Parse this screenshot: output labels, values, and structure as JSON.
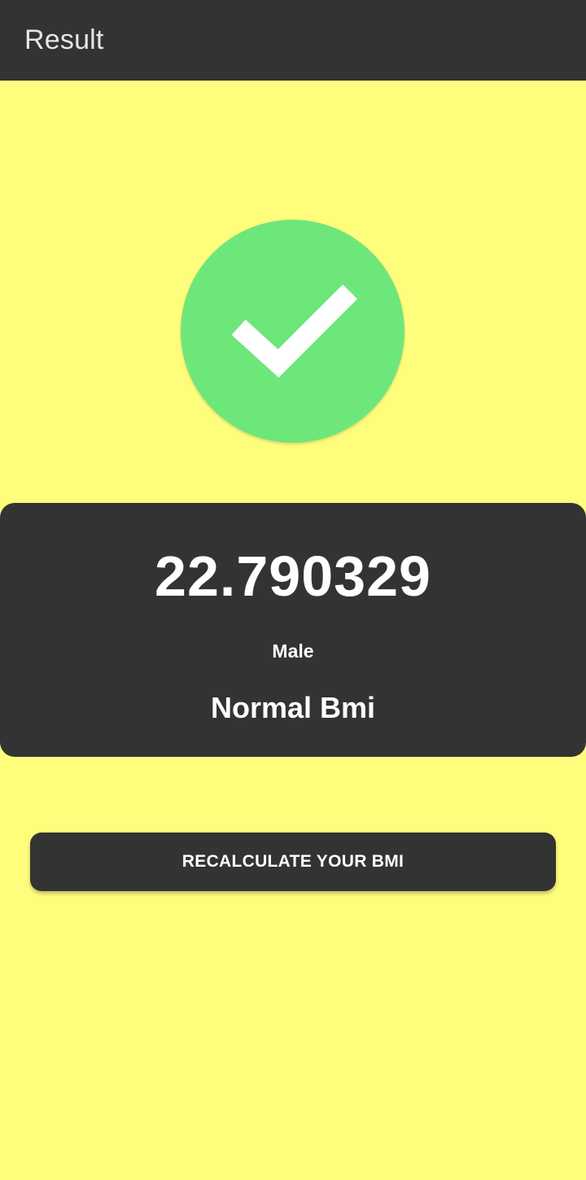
{
  "colors": {
    "app_bar_bg": "#333333",
    "app_bar_text": "#e6e6e6",
    "page_bg": "#fffd7c",
    "card_bg": "#333333",
    "card_text": "#ffffff",
    "button_bg": "#333333",
    "button_text": "#ffffff",
    "check_circle": "#6ee77a",
    "check_mark": "#ffffff"
  },
  "app_bar": {
    "title": "Result"
  },
  "status": {
    "icon": "check-circle-icon"
  },
  "result": {
    "bmi_value": "22.790329",
    "gender": "Male",
    "category": "Normal Bmi"
  },
  "actions": {
    "recalculate_label": "RECALCULATE YOUR BMI"
  }
}
